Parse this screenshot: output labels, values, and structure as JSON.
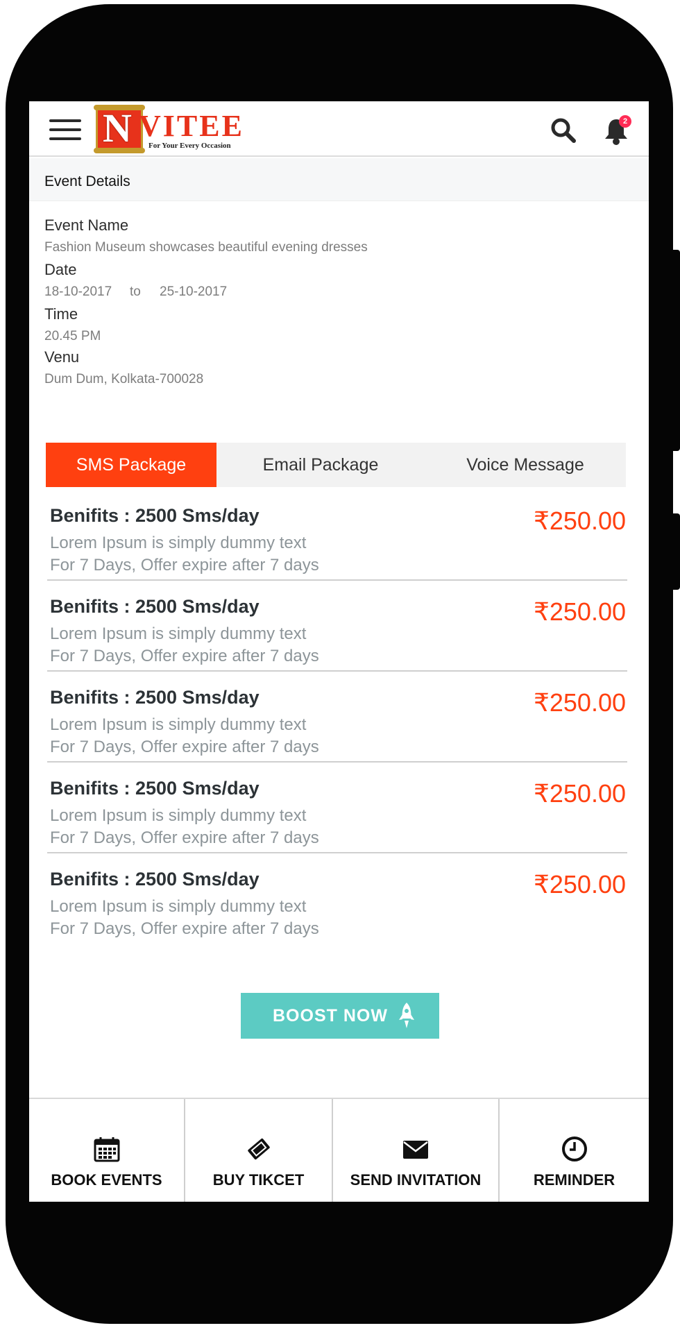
{
  "header": {
    "logo_letter": "N",
    "logo_word": "VITEE",
    "logo_tagline": "For Your Every Occasion",
    "notification_count": "2",
    "icons": [
      "menu-icon",
      "search-icon",
      "bell-icon"
    ]
  },
  "event_details": {
    "section_title": "Event Details",
    "name_label": "Event Name",
    "name_value": "Fashion Museum showcases beautiful evening dresses",
    "date_label": "Date",
    "date_start": "18-10-2017",
    "date_separator": "to",
    "date_end": "25-10-2017",
    "time_label": "Time",
    "time_value": "20.45 PM",
    "venue_label": "Venu",
    "venue_value": "Dum Dum, Kolkata-700028"
  },
  "tabs": [
    {
      "label": "SMS Package",
      "active": true
    },
    {
      "label": "Email Package",
      "active": false
    },
    {
      "label": "Voice Message",
      "active": false
    }
  ],
  "packages": [
    {
      "title": "Benifits : 2500 Sms/day",
      "description": "Lorem Ipsum is simply dummy text",
      "duration": "For 7 Days, Offer expire after 7 days",
      "price": "₹250.00"
    },
    {
      "title": "Benifits : 2500 Sms/day",
      "description": "Lorem Ipsum is simply dummy text",
      "duration": "For 7 Days, Offer expire after 7 days",
      "price": "₹250.00"
    },
    {
      "title": "Benifits : 2500 Sms/day",
      "description": "Lorem Ipsum is simply dummy text",
      "duration": "For 7 Days, Offer expire after 7 days",
      "price": "₹250.00"
    },
    {
      "title": "Benifits : 2500 Sms/day",
      "description": "Lorem Ipsum is simply dummy text",
      "duration": "For 7 Days, Offer expire after 7 days",
      "price": "₹250.00"
    },
    {
      "title": "Benifits : 2500 Sms/day",
      "description": "Lorem Ipsum is simply dummy text",
      "duration": "For 7 Days, Offer expire after 7 days",
      "price": "₹250.00"
    }
  ],
  "boost": {
    "label": "BOOST NOW",
    "icon": "rocket-icon"
  },
  "bottom_nav": [
    {
      "label": "BOOK EVENTS",
      "icon": "calendar-icon"
    },
    {
      "label": "BUY TIKCET",
      "icon": "ticket-icon"
    },
    {
      "label": "SEND INVITATION",
      "icon": "envelope-icon"
    },
    {
      "label": "REMINDER",
      "icon": "clock-icon"
    }
  ],
  "colors": {
    "accent": "#ff4010",
    "boost": "#5ccbc3",
    "badge": "#ff2b55",
    "muted_text": "#8d9599"
  }
}
